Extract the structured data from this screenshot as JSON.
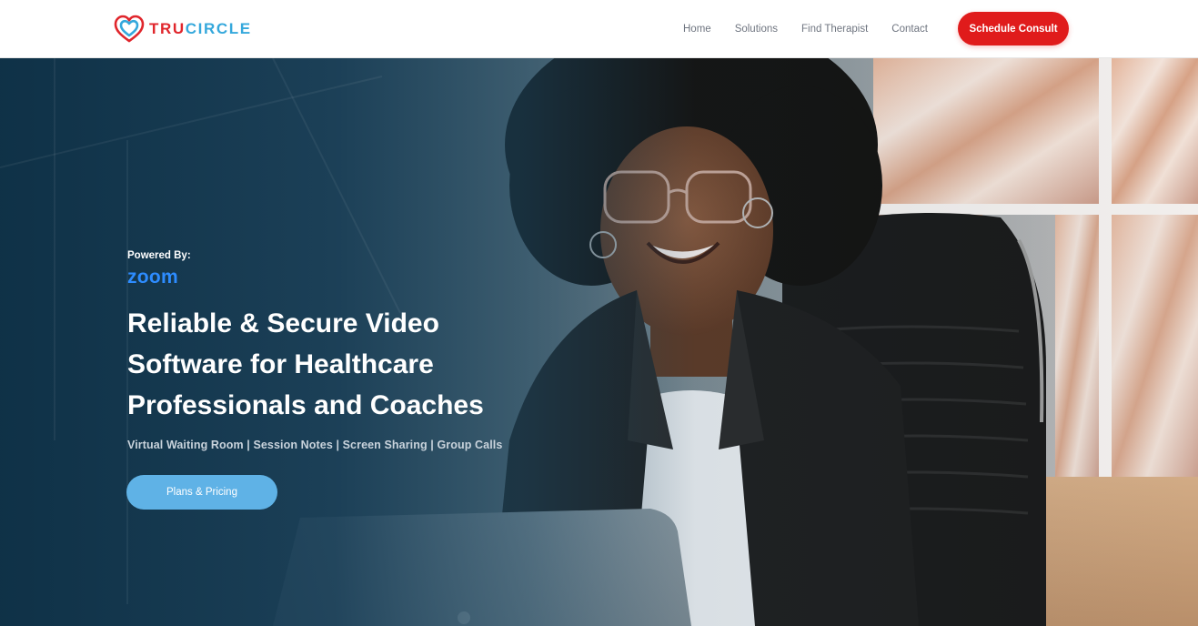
{
  "brand": {
    "name_part1": "TRU",
    "name_part2": "CIRCLE",
    "logo_icon": "heart-circle-icon",
    "colors": {
      "red": "#e0262c",
      "blue": "#35a8dc"
    }
  },
  "nav": {
    "items": [
      {
        "label": "Home"
      },
      {
        "label": "Solutions"
      },
      {
        "label": "Find Therapist"
      },
      {
        "label": "Contact"
      }
    ],
    "cta_label": "Schedule Consult",
    "cta_color": "#e01b1b"
  },
  "hero": {
    "powered_by": "Powered By:",
    "partner_logo_text": "zoom",
    "partner_color": "#2d8cff",
    "headline_lines": [
      "Reliable & Secure Video",
      "Software for Healthcare",
      "Professionals and Coaches"
    ],
    "subline": "Virtual Waiting Room | Session Notes | Screen Sharing | Group Calls",
    "button_label": "Plans & Pricing",
    "button_color": "#5fb2e6",
    "background_image": "woman-smiling-at-laptop-photo"
  }
}
